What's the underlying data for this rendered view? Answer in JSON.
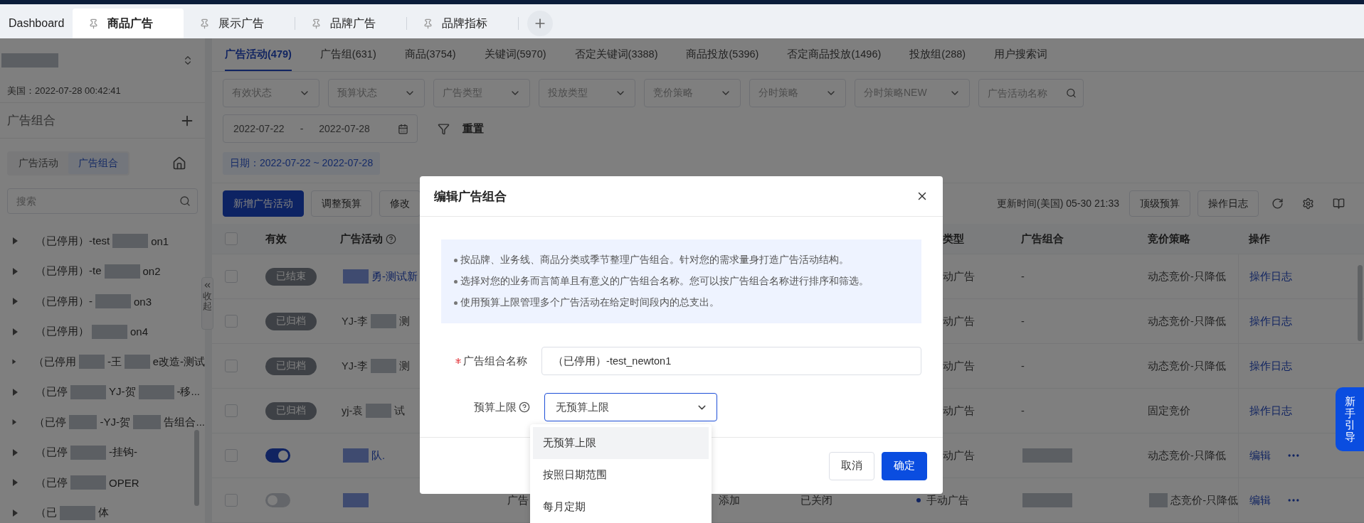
{
  "tabs": [
    {
      "label": "Dashboard",
      "pinned": false,
      "selected": false
    },
    {
      "label": "商品广告",
      "pinned": true,
      "selected": true
    },
    {
      "label": "展示广告",
      "pinned": true,
      "selected": false
    },
    {
      "label": "品牌广告",
      "pinned": true,
      "selected": false
    },
    {
      "label": "品牌指标",
      "pinned": true,
      "selected": false
    }
  ],
  "sidebar": {
    "time": "美国：2022-07-28 00:42:41",
    "section_title": "广告组合",
    "segments": [
      {
        "label": "广告活动",
        "selected": false
      },
      {
        "label": "广告组合",
        "selected": true
      }
    ],
    "search": {
      "placeholder": "搜索"
    },
    "tree": [
      {
        "expanded": false,
        "segments": [
          {
            "kind": "text",
            "text": "（已停用）-test"
          },
          {
            "kind": "redacted"
          },
          {
            "kind": "text",
            "text": "on1"
          }
        ]
      },
      {
        "expanded": false,
        "segments": [
          {
            "kind": "text",
            "text": "（已停用）-te"
          },
          {
            "kind": "redacted"
          },
          {
            "kind": "text",
            "text": "on2"
          }
        ]
      },
      {
        "expanded": false,
        "segments": [
          {
            "kind": "text",
            "text": "（已停用）-"
          },
          {
            "kind": "redacted"
          },
          {
            "kind": "text",
            "text": "on3"
          }
        ]
      },
      {
        "expanded": false,
        "segments": [
          {
            "kind": "text",
            "text": "（已停用）"
          },
          {
            "kind": "redacted"
          },
          {
            "kind": "text",
            "text": "on4"
          }
        ]
      },
      {
        "expanded": false,
        "segments": [
          {
            "kind": "text",
            "text": "（已停用"
          },
          {
            "kind": "redacted"
          },
          {
            "kind": "text",
            "text": "-王"
          },
          {
            "kind": "redacted"
          },
          {
            "kind": "text",
            "text": "e改造-测试"
          }
        ]
      },
      {
        "expanded": false,
        "segments": [
          {
            "kind": "text",
            "text": "（已停"
          },
          {
            "kind": "redacted"
          },
          {
            "kind": "text",
            "text": "YJ-贺"
          },
          {
            "kind": "redacted"
          },
          {
            "kind": "text",
            "text": "-移..."
          }
        ]
      },
      {
        "expanded": false,
        "segments": [
          {
            "kind": "text",
            "text": "（已停"
          },
          {
            "kind": "redacted"
          },
          {
            "kind": "text",
            "text": "-YJ-贺"
          },
          {
            "kind": "redacted"
          },
          {
            "kind": "text",
            "text": "告组合..."
          }
        ]
      },
      {
        "expanded": false,
        "segments": [
          {
            "kind": "text",
            "text": "（已停"
          },
          {
            "kind": "redacted"
          },
          {
            "kind": "text",
            "text": "-挂钩-"
          }
        ]
      },
      {
        "expanded": false,
        "segments": [
          {
            "kind": "text",
            "text": "（已停"
          },
          {
            "kind": "redacted"
          },
          {
            "kind": "text",
            "text": "OPER"
          }
        ]
      },
      {
        "expanded": false,
        "segments": [
          {
            "kind": "text",
            "text": "（已"
          },
          {
            "kind": "redacted"
          },
          {
            "kind": "text",
            "text": "体"
          }
        ]
      }
    ],
    "collapse_label": "收起"
  },
  "main": {
    "tabs": [
      {
        "label": "广告活动(479)",
        "selected": true
      },
      {
        "label": "广告组(631)",
        "selected": false
      },
      {
        "label": "商品(3754)",
        "selected": false
      },
      {
        "label": "关键词(5970)",
        "selected": false
      },
      {
        "label": "否定关键词(3388)",
        "selected": false
      },
      {
        "label": "商品投放(5396)",
        "selected": false
      },
      {
        "label": "否定商品投放(1496)",
        "selected": false
      },
      {
        "label": "投放组(288)",
        "selected": false
      },
      {
        "label": "用户搜索词",
        "selected": false
      }
    ],
    "filters": [
      {
        "kind": "select",
        "placeholder": "有效状态"
      },
      {
        "kind": "select",
        "placeholder": "预算状态"
      },
      {
        "kind": "select",
        "placeholder": "广告类型"
      },
      {
        "kind": "select",
        "placeholder": "投放类型"
      },
      {
        "kind": "select",
        "placeholder": "竞价策略"
      },
      {
        "kind": "select",
        "placeholder": "分时策略"
      },
      {
        "kind": "select",
        "placeholder": "分时策略NEW"
      },
      {
        "kind": "search",
        "placeholder": "广告活动名称"
      }
    ],
    "date_range": {
      "start": "2022-07-22",
      "separator": "-",
      "end": "2022-07-28"
    },
    "reset": "重置",
    "date_tag": "日期：2022-07-22 ~ 2022-07-28",
    "actions": [
      {
        "label": "新增广告活动",
        "primary": true
      },
      {
        "label": "调整预算",
        "primary": false
      },
      {
        "label": "修改",
        "primary": false
      }
    ],
    "updated": "更新时间(美国) 05-30 21:33",
    "right_actions": [
      "顶级预算",
      "操作日志"
    ],
    "table": {
      "header_checked": false,
      "columns": [
        {
          "label": "有效",
          "help": false
        },
        {
          "label": "广告活动",
          "help": true
        },
        {
          "label": "类型",
          "help": false
        },
        {
          "label": "广告组合",
          "help": false
        },
        {
          "label": "竞价策略",
          "help": false
        },
        {
          "label": "操作",
          "help": false
        }
      ],
      "rows": [
        {
          "kind": "covered",
          "checked": false,
          "status": {
            "kind": "badge",
            "label": "已结束"
          },
          "campaign": {
            "link": true,
            "segments": [
              {
                "kind": "redacted"
              },
              {
                "kind": "text",
                "text": "勇-测试新"
              }
            ]
          },
          "type": "动广告",
          "group": [
            {
              "kind": "text",
              "text": "-"
            }
          ],
          "strategy": [
            {
              "kind": "text",
              "text": "动态竞价-只降低"
            }
          ],
          "actions": [
            {
              "kind": "link",
              "label": "操作日志"
            }
          ]
        },
        {
          "kind": "covered",
          "checked": false,
          "status": {
            "kind": "badge",
            "label": "已归档"
          },
          "campaign": {
            "link": false,
            "segments": [
              {
                "kind": "text",
                "text": "YJ-李"
              },
              {
                "kind": "redacted"
              },
              {
                "kind": "text",
                "text": "测"
              }
            ]
          },
          "type": "动广告",
          "group": [
            {
              "kind": "text",
              "text": "-"
            }
          ],
          "strategy": [
            {
              "kind": "text",
              "text": "动态竞价-只降低"
            }
          ],
          "actions": [
            {
              "kind": "link",
              "label": "操作日志"
            }
          ]
        },
        {
          "kind": "covered",
          "checked": false,
          "status": {
            "kind": "badge",
            "label": "已归档"
          },
          "campaign": {
            "link": false,
            "segments": [
              {
                "kind": "text",
                "text": "YJ-李"
              },
              {
                "kind": "redacted"
              },
              {
                "kind": "text",
                "text": "测"
              }
            ]
          },
          "type": "动广告",
          "group": [
            {
              "kind": "text",
              "text": "-"
            }
          ],
          "strategy": [
            {
              "kind": "text",
              "text": "动态竞价-只降低"
            }
          ],
          "actions": [
            {
              "kind": "link",
              "label": "操作日志"
            }
          ]
        },
        {
          "kind": "covered",
          "checked": false,
          "status": {
            "kind": "badge",
            "label": "已归档"
          },
          "campaign": {
            "link": false,
            "segments": [
              {
                "kind": "text",
                "text": "yj-袁"
              },
              {
                "kind": "redacted"
              },
              {
                "kind": "text",
                "text": "试"
              }
            ]
          },
          "type": "动广告",
          "group": [
            {
              "kind": "text",
              "text": "-"
            }
          ],
          "strategy": [
            {
              "kind": "text",
              "text": "固定竞价"
            }
          ],
          "actions": [
            {
              "kind": "link",
              "label": "操作日志"
            }
          ]
        },
        {
          "kind": "covered",
          "checked": false,
          "status": {
            "kind": "toggle",
            "on": true
          },
          "campaign": {
            "link": true,
            "segments": [
              {
                "kind": "redacted"
              },
              {
                "kind": "text",
                "text": "队."
              }
            ]
          },
          "type": "动广告",
          "group": [
            {
              "kind": "redacted"
            }
          ],
          "strategy": [
            {
              "kind": "text",
              "text": "动态竞价-只降低"
            }
          ],
          "actions": [
            {
              "kind": "link",
              "label": "编辑"
            },
            {
              "kind": "more"
            }
          ]
        },
        {
          "kind": "open",
          "checked": false,
          "status": {
            "kind": "toggle",
            "on": false
          },
          "campaign": {
            "link": true,
            "segments": [
              {
                "kind": "redacted"
              }
            ]
          },
          "column_4": "广告",
          "column_5": "添加",
          "column_6": "已关闭",
          "type": "手动广告",
          "group": [
            {
              "kind": "redacted"
            }
          ],
          "strategy": [
            {
              "kind": "redacted"
            },
            {
              "kind": "text",
              "text": "态竞价-只降低"
            }
          ],
          "actions": [
            {
              "kind": "link",
              "label": "编辑"
            },
            {
              "kind": "more"
            }
          ]
        }
      ]
    }
  },
  "modal": {
    "title": "编辑广告组合",
    "tips": [
      "按品牌、业务线、商品分类或季节整理广告组合。针对您的需求量身打造广告活动结构。",
      "选择对您的业务而言简单且有意义的广告组合名称。您可以按广告组合名称进行排序和筛选。",
      "使用预算上限管理多个广告活动在给定时间段内的总支出。"
    ],
    "fields": [
      {
        "kind": "text",
        "label": "广告组合名称",
        "required": true,
        "help": false,
        "value": "（已停用）-test_newton1"
      },
      {
        "kind": "select",
        "label": "预算上限",
        "required": false,
        "help": true,
        "value": "无预算上限"
      }
    ],
    "options": [
      {
        "label": "无预算上限",
        "selected": true
      },
      {
        "label": "按照日期范围",
        "selected": false
      },
      {
        "label": "每月定期",
        "selected": false
      }
    ],
    "buttons": [
      {
        "label": "取消",
        "primary": false
      },
      {
        "label": "确定",
        "primary": true
      }
    ]
  },
  "guide_button": "新手引导"
}
